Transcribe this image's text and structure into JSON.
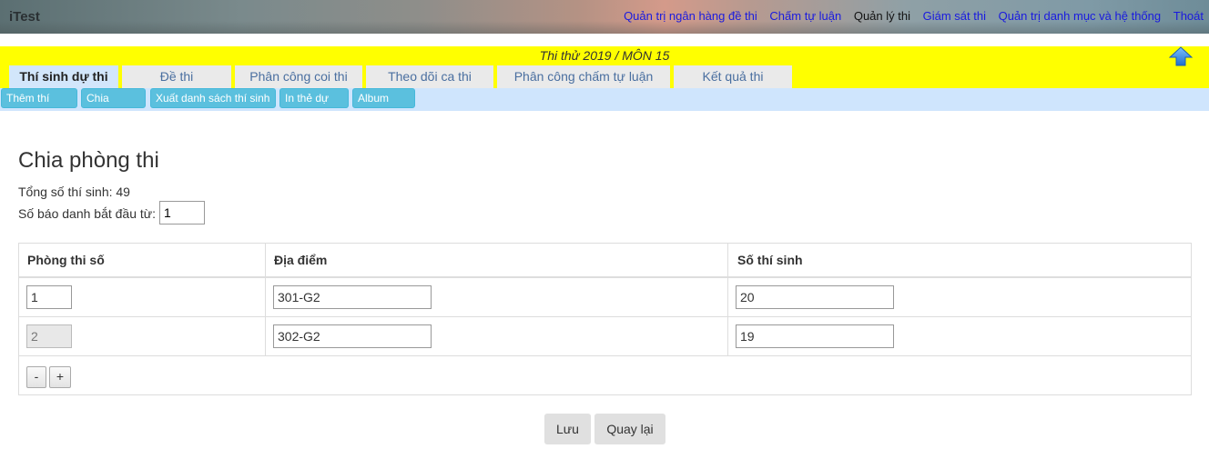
{
  "app": {
    "brand": "iTest"
  },
  "topnav": {
    "items": [
      {
        "label": "Quản trị ngân hàng đề thi"
      },
      {
        "label": "Chấm tự luận"
      },
      {
        "label": "Quản lý thi"
      },
      {
        "label": "Giám sát thi"
      },
      {
        "label": "Quản trị danh mục và hệ thống"
      },
      {
        "label": "Thoát"
      }
    ],
    "active_index": 2
  },
  "exam": {
    "title": "Thi thử 2019 / MÔN 15"
  },
  "tabs": [
    {
      "label": "Thí sinh dự thi"
    },
    {
      "label": "Đề thi"
    },
    {
      "label": "Phân công coi thi"
    },
    {
      "label": "Theo dõi ca thi"
    },
    {
      "label": "Phân công chấm tự luận"
    },
    {
      "label": "Kết quả thi"
    }
  ],
  "actions": [
    {
      "label": "Thêm thí sinh"
    },
    {
      "label": "Chia phòng"
    },
    {
      "label": "Xuất danh sách thí sinh"
    },
    {
      "label": "In thẻ dự thi"
    },
    {
      "label": "Album ảnh"
    }
  ],
  "main": {
    "title": "Chia phòng thi",
    "total_label": "Tổng số thí sinh: 49",
    "start_label": "Số báo danh bắt đầu từ:",
    "start_value": "1"
  },
  "table": {
    "headers": [
      "Phòng thi số",
      "Địa điểm",
      "Số thí sinh"
    ],
    "rows": [
      {
        "room": "1",
        "location": "301-G2",
        "count": "20"
      },
      {
        "room": "2",
        "location": "302-G2",
        "count": "19"
      }
    ],
    "minus": "-",
    "plus": "+"
  },
  "buttons": {
    "save": "Lưu",
    "back": "Quay lại"
  },
  "colors": {
    "yellow_bar": "#ffff00",
    "action_button": "#5bc0de",
    "active_tab": "#d2e6fb",
    "link": "#1a1adf"
  }
}
